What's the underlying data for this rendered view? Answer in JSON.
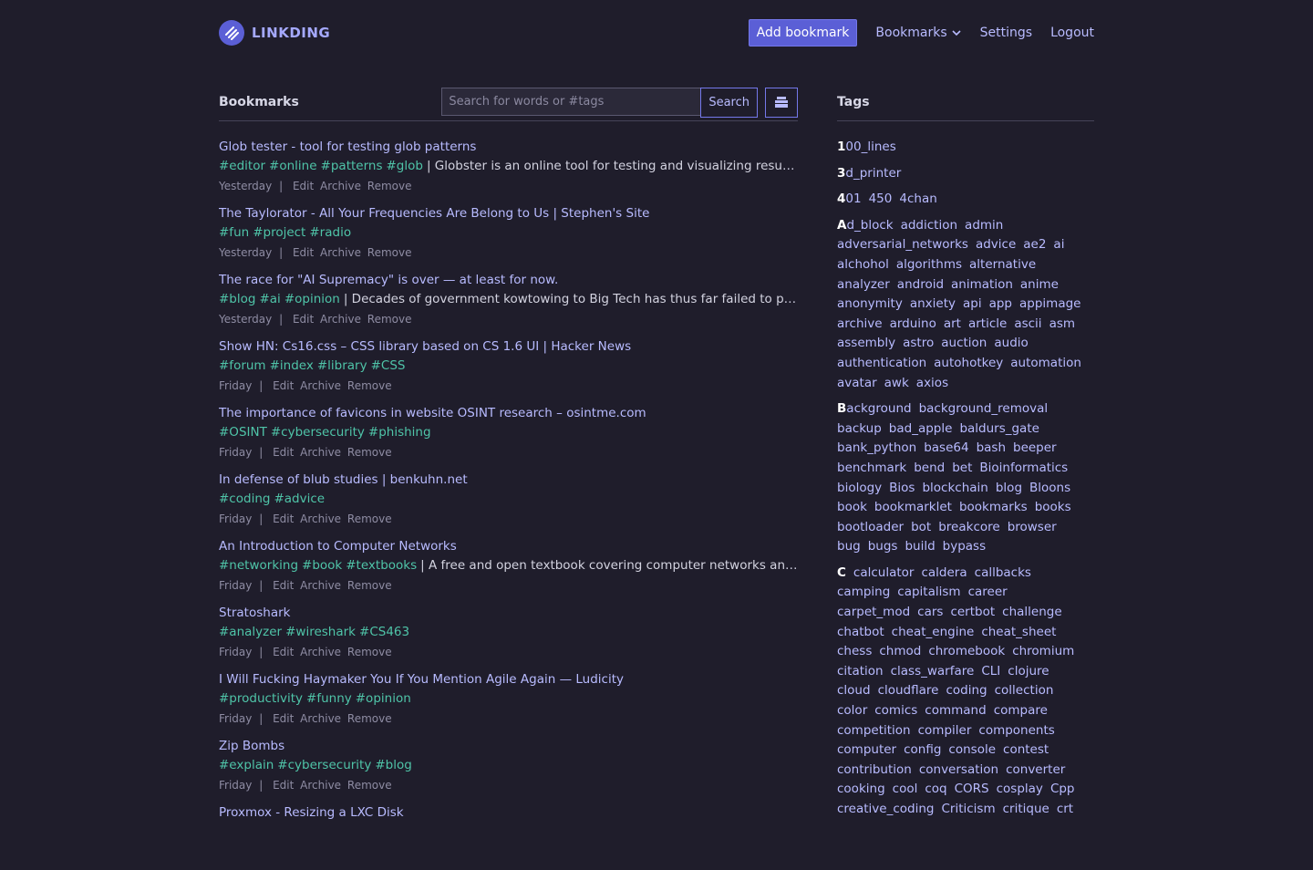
{
  "brand": {
    "name": "LINKDING"
  },
  "nav": {
    "add": "Add bookmark",
    "bookmarks": "Bookmarks",
    "settings": "Settings",
    "logout": "Logout"
  },
  "main": {
    "title": "Bookmarks",
    "search_placeholder": "Search for words or #tags",
    "search_button": "Search"
  },
  "actions": {
    "edit": "Edit",
    "archive": "Archive",
    "remove": "Remove",
    "sep": "|"
  },
  "bookmarks": [
    {
      "title": "Glob tester - tool for testing glob patterns",
      "tags": [
        "#editor",
        "#online",
        "#patterns",
        "#glob"
      ],
      "desc": "| Globster is an online tool for testing and visualizing results of glob patterns",
      "date": "Yesterday"
    },
    {
      "title": "The Taylorator - All Your Frequencies Are Belong to Us | Stephen's Site",
      "tags": [
        "#fun",
        "#project",
        "#radio"
      ],
      "desc": "",
      "date": "Yesterday"
    },
    {
      "title": "The race for \"AI Supremacy\" is over — at least for now.",
      "tags": [
        "#blog",
        "#ai",
        "#opinion"
      ],
      "desc": "| Decades of government kowtowing to Big Tech has thus far failed to produce",
      "date": "Yesterday"
    },
    {
      "title": "Show HN: Cs16.css – CSS library based on CS 1.6 UI | Hacker News",
      "tags": [
        "#forum",
        "#index",
        "#library",
        "#CSS"
      ],
      "desc": "",
      "date": "Friday"
    },
    {
      "title": "The importance of favicons in website OSINT research – osintme.com",
      "tags": [
        "#OSINT",
        "#cybersecurity",
        "#phishing"
      ],
      "desc": "",
      "date": "Friday"
    },
    {
      "title": "In defense of blub studies | benkuhn.net",
      "tags": [
        "#coding",
        "#advice"
      ],
      "desc": "",
      "date": "Friday"
    },
    {
      "title": "An Introduction to Computer Networks",
      "tags": [
        "#networking",
        "#book",
        "#textbooks"
      ],
      "desc": "| A free and open textbook covering computer networks and network",
      "date": "Friday"
    },
    {
      "title": "Stratoshark",
      "tags": [
        "#analyzer",
        "#wireshark",
        "#CS463"
      ],
      "desc": "",
      "date": "Friday"
    },
    {
      "title": "I Will Fucking Haymaker You If You Mention Agile Again — Ludicity",
      "tags": [
        "#productivity",
        "#funny",
        "#opinion"
      ],
      "desc": "",
      "date": "Friday"
    },
    {
      "title": "Zip Bombs",
      "tags": [
        "#explain",
        "#cybersecurity",
        "#blog"
      ],
      "desc": "",
      "date": "Friday"
    },
    {
      "title": "Proxmox - Resizing a LXC Disk",
      "tags": [],
      "desc": "",
      "date": ""
    }
  ],
  "tags_panel": {
    "title": "Tags",
    "groups": [
      {
        "initial": "1",
        "tags": [
          "100_lines"
        ]
      },
      {
        "initial": "3",
        "tags": [
          "3d_printer"
        ]
      },
      {
        "initial": "4",
        "tags": [
          "401",
          "450",
          "4chan"
        ]
      },
      {
        "initial": "A",
        "tags": [
          "Ad_block",
          "addiction",
          "admin",
          "adversarial_networks",
          "advice",
          "ae2",
          "ai",
          "alchohol",
          "algorithms",
          "alternative",
          "analyzer",
          "android",
          "animation",
          "anime",
          "anonymity",
          "anxiety",
          "api",
          "app",
          "appimage",
          "archive",
          "arduino",
          "art",
          "article",
          "ascii",
          "asm",
          "assembly",
          "astro",
          "auction",
          "audio",
          "authentication",
          "autohotkey",
          "automation",
          "avatar",
          "awk",
          "axios"
        ]
      },
      {
        "initial": "B",
        "tags": [
          "Background",
          "background_removal",
          "backup",
          "bad_apple",
          "baldurs_gate",
          "bank_python",
          "base64",
          "bash",
          "beeper",
          "benchmark",
          "bend",
          "bet",
          "Bioinformatics",
          "biology",
          "Bios",
          "blockchain",
          "blog",
          "Bloons",
          "book",
          "bookmarklet",
          "bookmarks",
          "books",
          "bootloader",
          "bot",
          "breakcore",
          "browser",
          "bug",
          "bugs",
          "build",
          "bypass"
        ]
      },
      {
        "initial": "C",
        "tags": [
          "C",
          "calculator",
          "caldera",
          "callbacks",
          "camping",
          "capitalism",
          "career",
          "carpet_mod",
          "cars",
          "certbot",
          "challenge",
          "chatbot",
          "cheat_engine",
          "cheat_sheet",
          "chess",
          "chmod",
          "chromebook",
          "chromium",
          "citation",
          "class_warfare",
          "CLI",
          "clojure",
          "cloud",
          "cloudflare",
          "coding",
          "collection",
          "color",
          "comics",
          "command",
          "compare",
          "competition",
          "compiler",
          "components",
          "computer",
          "config",
          "console",
          "contest",
          "contribution",
          "conversation",
          "converter",
          "cooking",
          "cool",
          "coq",
          "CORS",
          "cosplay",
          "Cpp",
          "creative_coding",
          "Criticism",
          "critique",
          "crt"
        ]
      }
    ]
  }
}
